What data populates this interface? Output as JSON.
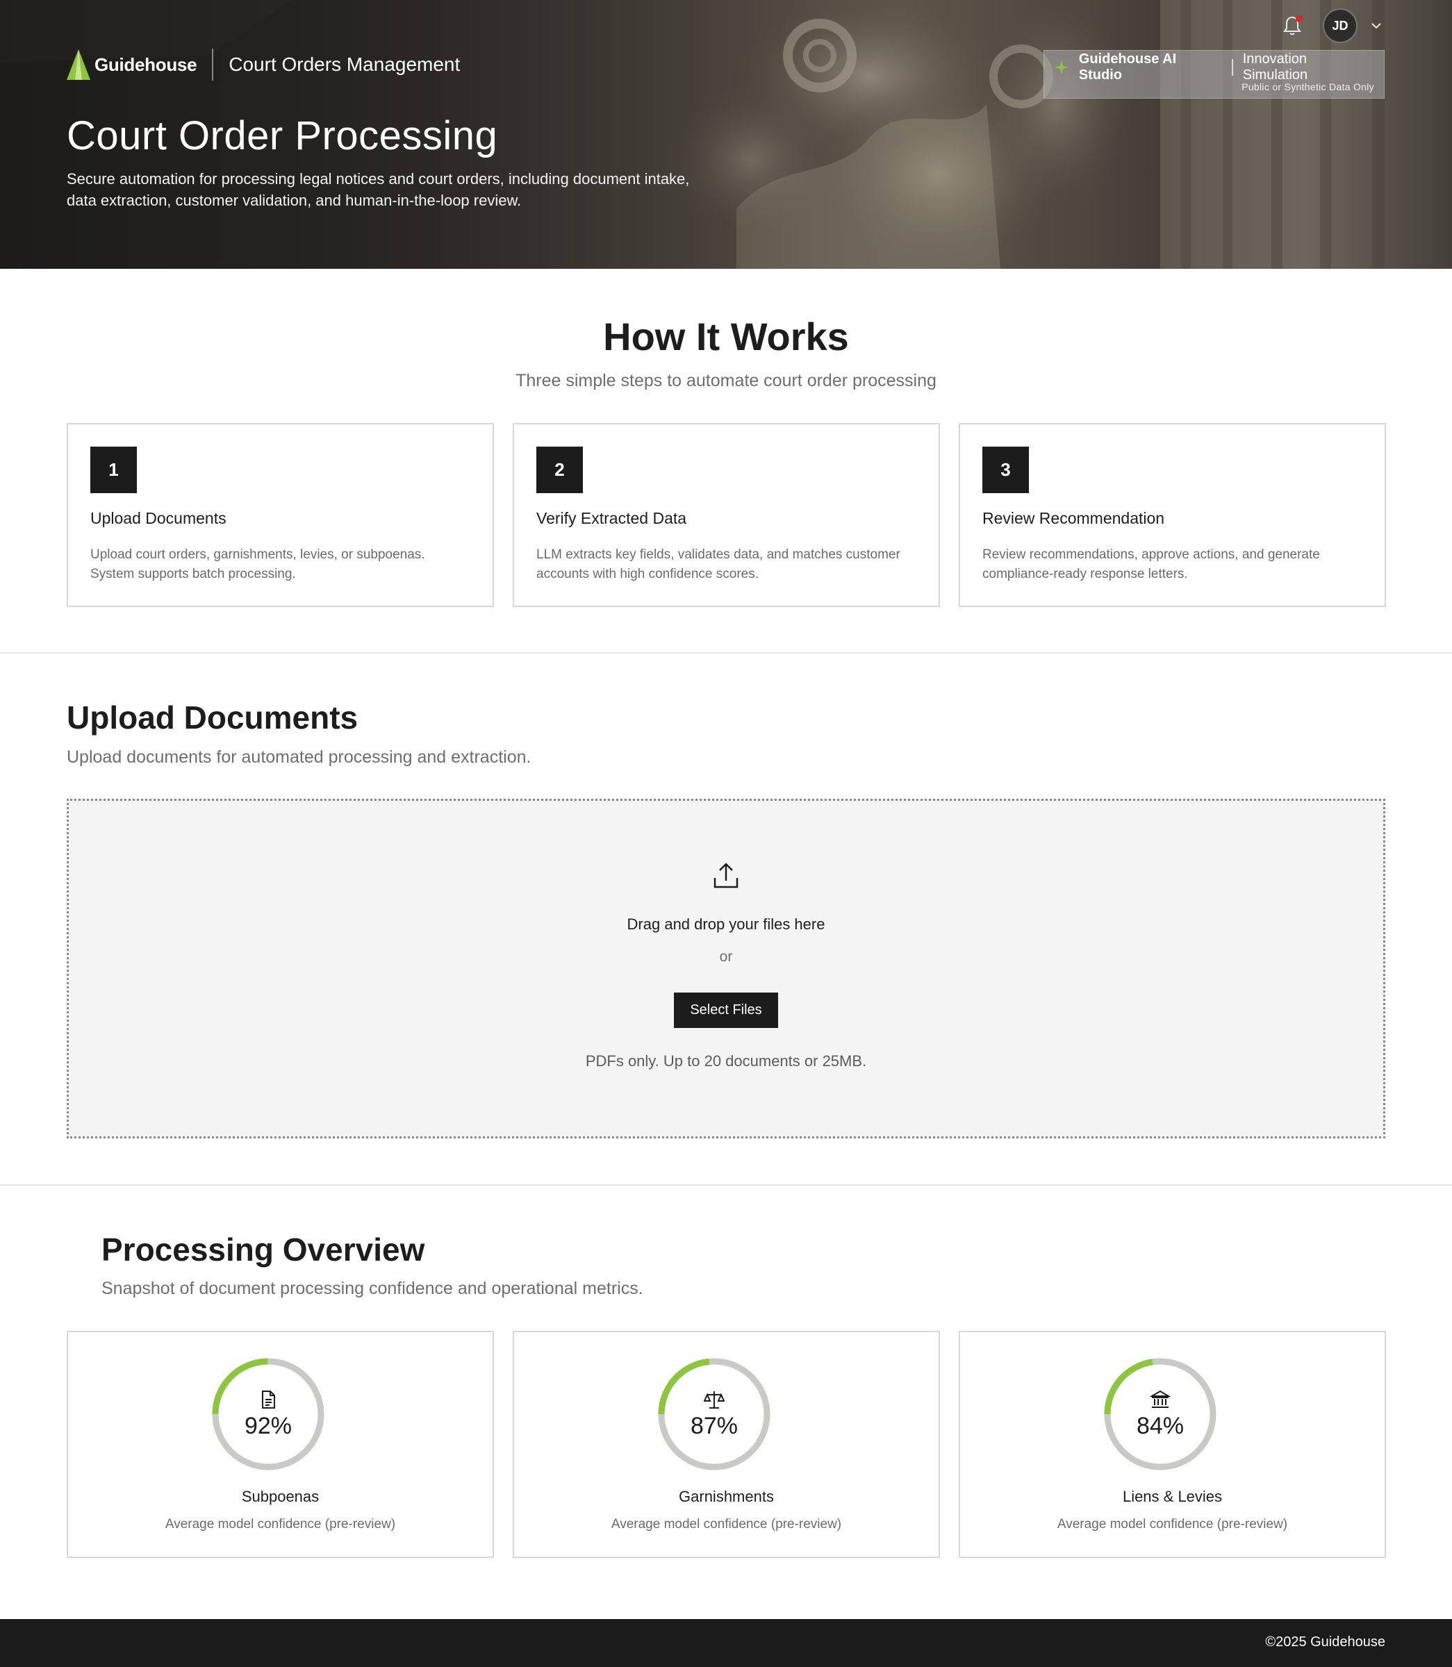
{
  "header": {
    "brand_name": "Guidehouse",
    "app_name": "Court Orders Management",
    "avatar_initials": "JD",
    "notification_badge": "unread-dot",
    "studio": {
      "name": "Guidehouse AI Studio",
      "mode": "Innovation Simulation",
      "note": "Public or Synthetic Data Only"
    }
  },
  "hero": {
    "title": "Court Order Processing",
    "description": "Secure automation for processing legal notices and court orders, including document intake, data extraction, customer validation, and human-in-the-loop review."
  },
  "how_it_works": {
    "title": "How It Works",
    "subtitle": "Three simple steps to automate court order processing",
    "steps": [
      {
        "number": "1",
        "title": "Upload Documents",
        "description": "Upload court orders, garnishments, levies, or subpoenas. System supports batch processing."
      },
      {
        "number": "2",
        "title": "Verify Extracted Data",
        "description": "LLM extracts key fields, validates data, and matches customer accounts with high confidence scores."
      },
      {
        "number": "3",
        "title": "Review Recommendation",
        "description": "Review recommendations, approve actions, and generate compliance-ready response letters."
      }
    ]
  },
  "upload": {
    "title": "Upload Documents",
    "subtitle": "Upload documents for automated processing and extraction.",
    "drop_text": "Drag and drop your files here",
    "or_text": "or",
    "button_label": "Select Files",
    "limits": "PDFs only. Up to 20 documents or 25MB."
  },
  "overview": {
    "title": "Processing Overview",
    "subtitle": "Snapshot of document processing confidence and operational metrics.",
    "metrics": [
      {
        "label": "Subpoenas",
        "value": "92%",
        "icon": "document-icon",
        "note": "Average model confidence (pre-review)"
      },
      {
        "label": "Garnishments",
        "value": "87%",
        "icon": "scales-icon",
        "note": "Average model confidence (pre-review)"
      },
      {
        "label": "Liens & Levies",
        "value": "84%",
        "icon": "bank-icon",
        "note": "Average model confidence (pre-review)"
      }
    ]
  },
  "footer": {
    "copyright": "©2025 Guidehouse"
  },
  "colors": {
    "accent_green": "#8cc63f",
    "ring_track": "#c9c9c6",
    "dark": "#1c1c1c",
    "notification_red": "#e0242b"
  }
}
